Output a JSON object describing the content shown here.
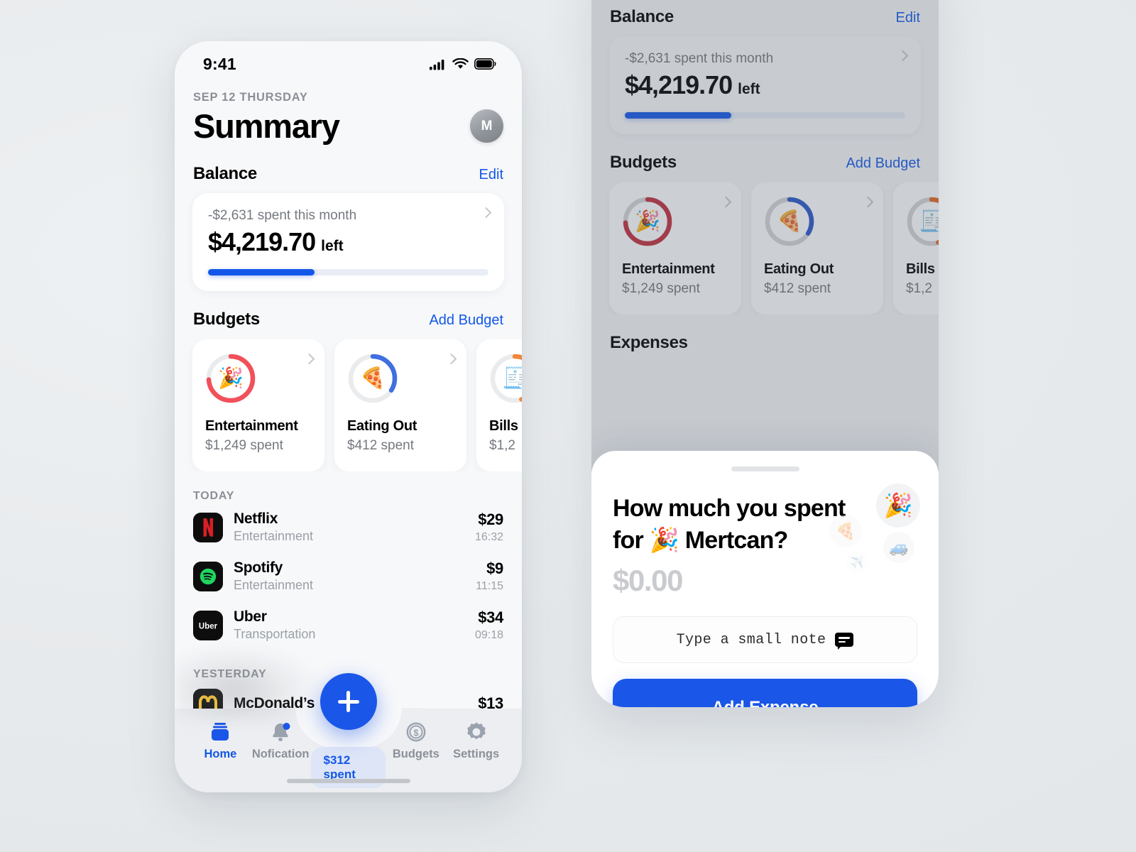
{
  "background_color": "#e8ebed",
  "accent_color": "#1257e8",
  "phone_light": {
    "status_bar": {
      "time": "9:41",
      "icons": [
        "cellular-signal-icon",
        "wifi-icon",
        "battery-icon"
      ]
    },
    "header": {
      "date": "SEP 12 THURSDAY",
      "title": "Summary",
      "avatar_initial": "M"
    },
    "balance": {
      "section_title": "Balance",
      "edit_label": "Edit",
      "spent_text": "-$2,631 spent this month",
      "amount": "$4,219.70",
      "amount_suffix": "left",
      "progress_percent": 38
    },
    "budgets": {
      "section_title": "Budgets",
      "add_label": "Add Budget",
      "cards": [
        {
          "emoji": "🎉",
          "name": "Entertainment",
          "spent": "$1,249 spent",
          "ring_color": "#f2505a",
          "ring_percent": 74
        },
        {
          "emoji": "🍕",
          "name": "Eating Out",
          "spent": "$412 spent",
          "ring_color": "#3f6fe0",
          "ring_percent": 34
        },
        {
          "emoji": "🧾",
          "name": "Bills",
          "spent": "$1,2",
          "ring_color": "#f0873c",
          "ring_percent": 45
        }
      ]
    },
    "transactions": [
      {
        "group": "TODAY",
        "items": [
          {
            "logo": "netflix-logo",
            "name": "Netflix",
            "category": "Entertainment",
            "amount": "$29",
            "time": "16:32"
          },
          {
            "logo": "spotify-logo",
            "name": "Spotify",
            "category": "Entertainment",
            "amount": "$9",
            "time": "11:15"
          },
          {
            "logo": "uber-logo",
            "name": "Uber",
            "category": "Transportation",
            "amount": "$34",
            "time": "09:18"
          }
        ]
      },
      {
        "group": "YESTERDAY",
        "items": [
          {
            "logo": "mcdonalds-logo",
            "name": "McDonald’s",
            "category": "",
            "amount": "$13",
            "time": ""
          }
        ]
      }
    ],
    "tab_bar": {
      "items": [
        {
          "icon": "home-icon",
          "label": "Home",
          "active": true
        },
        {
          "icon": "bell-icon",
          "label": "Nofication",
          "active": false
        },
        {
          "icon": "dollar-coin-icon",
          "label": "Budgets",
          "active": false
        },
        {
          "icon": "gear-icon",
          "label": "Settings",
          "active": false
        }
      ],
      "spent_pill": "$312 spent",
      "fab_icon": "plus-icon"
    }
  },
  "phone_dimmed": {
    "balance": {
      "section_title": "Balance",
      "edit_label": "Edit",
      "spent_text": "-$2,631 spent this month",
      "amount": "$4,219.70",
      "amount_suffix": "left",
      "progress_percent": 38
    },
    "budgets": {
      "section_title": "Budgets",
      "add_label": "Add Budget",
      "cards": [
        {
          "emoji": "🎉",
          "name": "Entertainment",
          "spent": "$1,249 spent",
          "ring_color": "#c22d3c",
          "ring_percent": 74
        },
        {
          "emoji": "🍕",
          "name": "Eating Out",
          "spent": "$412 spent",
          "ring_color": "#2a57c9",
          "ring_percent": 34
        },
        {
          "emoji": "🧾",
          "name": "Bills",
          "spent": "$1,2",
          "ring_color": "#e2681f",
          "ring_percent": 45
        }
      ]
    },
    "expenses_title": "Expenses",
    "sheet": {
      "question_line1": "How much you spent",
      "question_prefix": "for ",
      "question_emoji": "🎉",
      "question_name": " Mertcan?",
      "amount_placeholder": "$0.00",
      "note_placeholder": "Type a small note",
      "note_icon": "speech-bubble-icon",
      "submit_label": "Add Expense",
      "emoji_cluster": [
        "🎉",
        "🍕",
        "🚙",
        "✈️"
      ]
    }
  }
}
